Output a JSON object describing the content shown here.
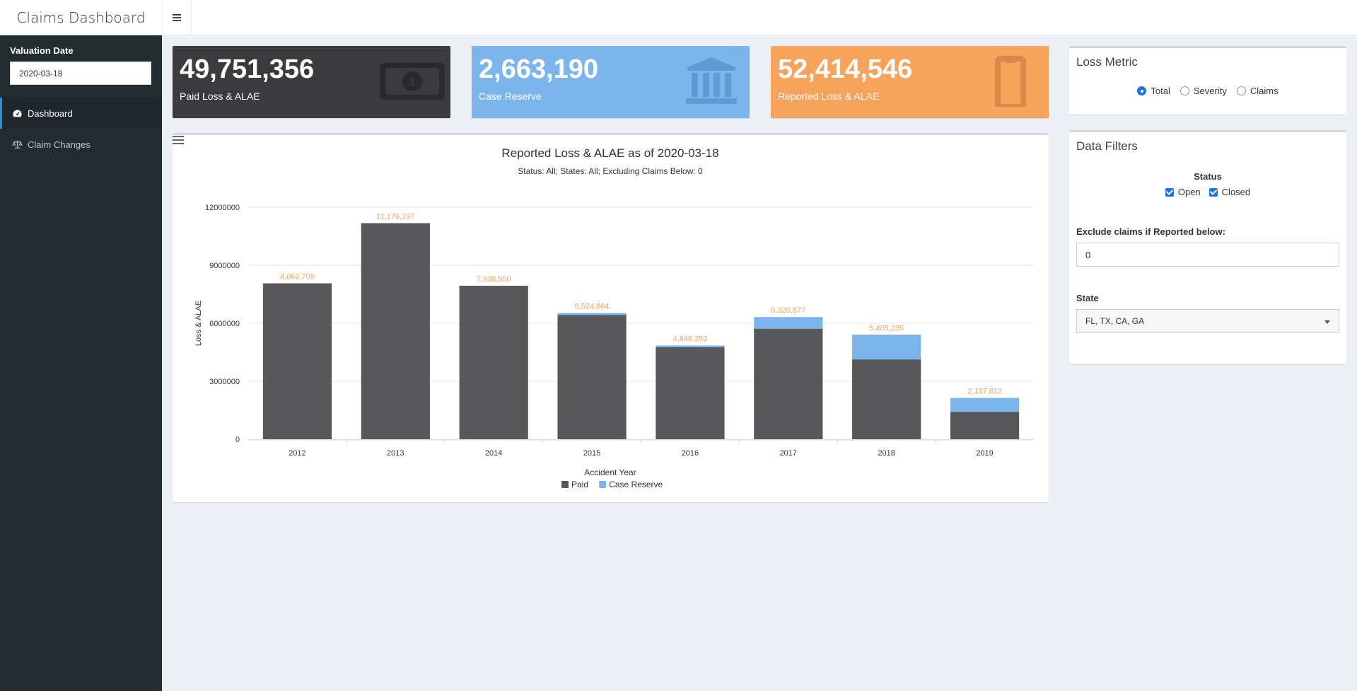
{
  "header": {
    "app_title": "Claims Dashboard"
  },
  "sidebar": {
    "valuation_label": "Valuation Date",
    "valuation_date": "2020-03-18",
    "items": [
      {
        "label": "Dashboard",
        "icon": "dashboard-icon",
        "active": true
      },
      {
        "label": "Claim Changes",
        "icon": "balance-scale-icon",
        "active": false
      }
    ]
  },
  "value_boxes": [
    {
      "value": "49,751,356",
      "caption": "Paid Loss & ALAE",
      "color": "#3b3b3e",
      "icon": "money-bill-icon"
    },
    {
      "value": "2,663,190",
      "caption": "Case Reserve",
      "color": "#7cb5ec",
      "icon": "university-icon"
    },
    {
      "value": "52,414,546",
      "caption": "Reported Loss & ALAE",
      "color": "#f7a35c",
      "icon": "clipboard-icon"
    }
  ],
  "loss_metric": {
    "title": "Loss Metric",
    "options": [
      "Total",
      "Severity",
      "Claims"
    ],
    "selected": "Total"
  },
  "filters": {
    "title": "Data Filters",
    "status_label": "Status",
    "status_options": [
      "Open",
      "Closed"
    ],
    "exclude_label": "Exclude claims if Reported below:",
    "exclude_value": "0",
    "state_label": "State",
    "state_value": "FL, TX, CA, GA"
  },
  "chart_data": {
    "type": "bar",
    "stacked": true,
    "title": "Reported Loss & ALAE as of 2020-03-18",
    "subtitle": "Status: All; States: All; Excluding Claims Below: 0",
    "xlabel": "Accident Year",
    "ylabel": "Loss & ALAE",
    "ylim": [
      0,
      12000000
    ],
    "yticks": [
      0,
      3000000,
      6000000,
      9000000,
      12000000
    ],
    "categories": [
      "2012",
      "2013",
      "2014",
      "2015",
      "2016",
      "2017",
      "2018",
      "2019"
    ],
    "series": [
      {
        "name": "Paid",
        "color": "#58585b",
        "values": [
          8062709,
          11176197,
          7938500,
          6420000,
          4760000,
          5720000,
          4130000,
          1420000
        ]
      },
      {
        "name": "Case Reserve",
        "color": "#7cb5ec",
        "values": [
          0,
          0,
          0,
          104864,
          88352,
          600877,
          1275235,
          717812
        ]
      }
    ],
    "totals_labels": [
      "8,062,709",
      "11,176,197",
      "7,938,500",
      "6,524,864",
      "4,848,352",
      "6,320,877",
      "5,405,235",
      "2,137,812"
    ],
    "label_color": "#f7a35c",
    "legend_position": "bottom-center"
  }
}
